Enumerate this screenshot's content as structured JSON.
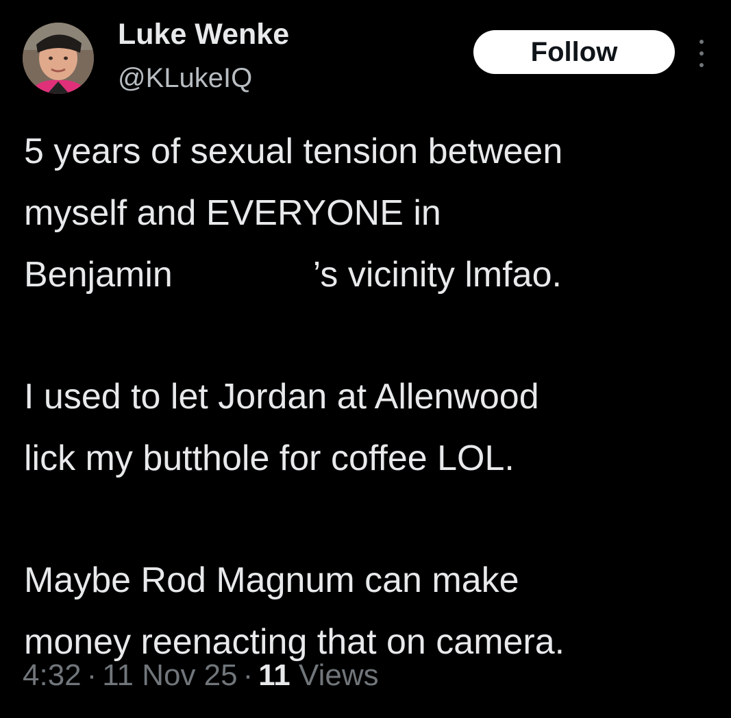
{
  "author": {
    "name": "Luke Wenke",
    "handle": "@KLukeIQ"
  },
  "actions": {
    "follow_label": "Follow",
    "more_icon": "more-vertical-icon"
  },
  "tweet": {
    "line1": "5 years of sexual tension between",
    "line2": "myself and EVERYONE in",
    "line3_before": "Benjamin",
    "line3_after": "’s vicinity lmfao.",
    "line4": "I used to let Jordan at Allenwood",
    "line5": "lick my butthole for coffee LOL.",
    "line6": "Maybe Rod Magnum can make",
    "line7": "money reenacting that on camera."
  },
  "meta": {
    "time": "4:32",
    "separator": "·",
    "date": "11 Nov 25",
    "views_count": "11",
    "views_label": "Views"
  },
  "colors": {
    "background": "#000000",
    "primary_text": "#e7e9ea",
    "secondary_text": "#71767b",
    "follow_bg": "#ffffff"
  }
}
